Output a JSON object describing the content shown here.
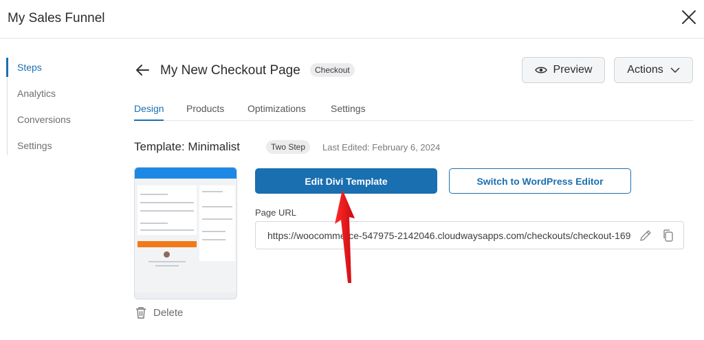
{
  "app": {
    "title": "My Sales Funnel",
    "close_icon": "close-icon"
  },
  "sidebar": {
    "items": [
      {
        "label": "Steps",
        "active": true
      },
      {
        "label": "Analytics",
        "active": false
      },
      {
        "label": "Conversions",
        "active": false
      },
      {
        "label": "Settings",
        "active": false
      }
    ]
  },
  "page": {
    "title": "My New Checkout Page",
    "type_badge": "Checkout",
    "preview_label": "Preview",
    "actions_label": "Actions"
  },
  "tabs": [
    {
      "label": "Design",
      "active": true
    },
    {
      "label": "Products",
      "active": false
    },
    {
      "label": "Optimizations",
      "active": false
    },
    {
      "label": "Settings",
      "active": false
    }
  ],
  "template": {
    "title": "Template: Minimalist",
    "badge": "Two Step",
    "last_edited": "Last Edited: February 6, 2024",
    "delete_label": "Delete"
  },
  "editor": {
    "primary_button": "Edit Divi Template",
    "secondary_button": "Switch to WordPress Editor",
    "url_label": "Page URL",
    "url_value": "https://woocommerce-547975-2142046.cloudwaysapps.com/checkouts/checkout-169"
  },
  "colors": {
    "accent": "#1a6fb0",
    "annotation_arrow": "#e8141c",
    "thumb_cta": "#f07a1a"
  }
}
